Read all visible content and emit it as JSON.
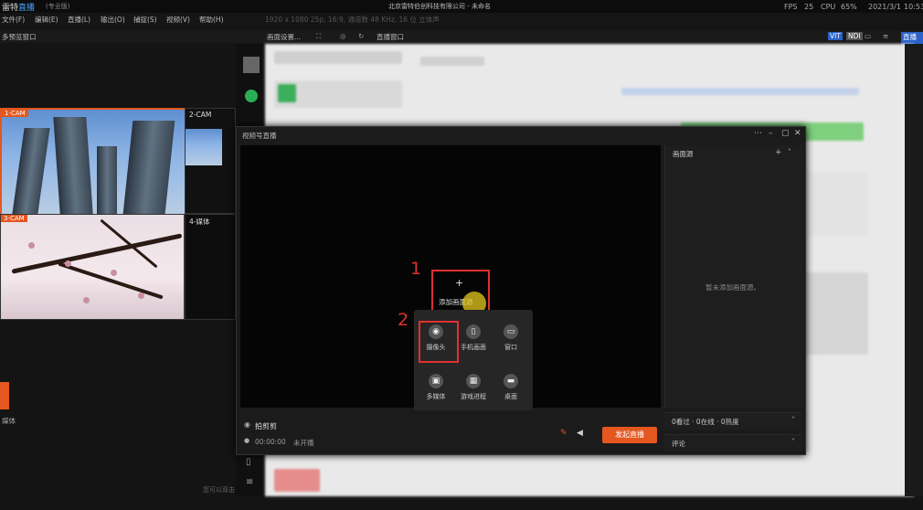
{
  "host": {
    "logo_a": "雷特",
    "logo_b": "直播",
    "edition": "(专业版)",
    "title": "北京雷特伯创科技有限公司 - 未命名",
    "fps_label": "FPS",
    "fps_value": "25",
    "cpu_label": "CPU",
    "cpu_value": "65%",
    "date": "2021/3/1",
    "time": "10:53"
  },
  "menu": {
    "items": [
      "文件(F)",
      "编辑(E)",
      "直播(L)",
      "输出(O)",
      "捕捉(S)",
      "视频(V)",
      "帮助(H)"
    ],
    "info": "1920 x 1080 25p, 16:9, 通道数 48 KHz, 16 位 立体声"
  },
  "toolbar": {
    "preview": "多预览窗口",
    "settings": "画面设置...",
    "live": "直播窗口",
    "badge_a": "VIT",
    "badge_b": "NDI",
    "right": "直播窗口"
  },
  "cams": {
    "cam1": "1-CAM",
    "cam2": "2-CAM",
    "cam3": "3-CAM",
    "cam4": "4-媒体"
  },
  "left_labels": {
    "media": "媒体",
    "hint": "您可以双击"
  },
  "dialog": {
    "title": "视频号直播",
    "add_source": "添加画面源",
    "side_header": "画面源",
    "empty": "暂未添加画面源。",
    "viewers": "0看过 · 0在线 · 0热度",
    "comments": "评论",
    "streamer": "拍剪剪",
    "elapsed": "00:00:00",
    "status": "未开播",
    "go_live": "发起直播",
    "step1": "1",
    "step2": "2",
    "popup": [
      {
        "icon": "camera-icon",
        "glyph": "◉",
        "label": "摄像头"
      },
      {
        "icon": "phone-icon",
        "glyph": "▯",
        "label": "手机画面"
      },
      {
        "icon": "window-icon",
        "glyph": "▭",
        "label": "窗口"
      },
      {
        "icon": "media-icon",
        "glyph": "▣",
        "label": "多媒体"
      },
      {
        "icon": "game-icon",
        "glyph": "▦",
        "label": "游戏进程"
      },
      {
        "icon": "desktop-icon",
        "glyph": "▬",
        "label": "桌面"
      }
    ]
  },
  "colors": {
    "accent": "#e4571f",
    "highlight": "#e03030",
    "brand": "#4aa3ff"
  }
}
